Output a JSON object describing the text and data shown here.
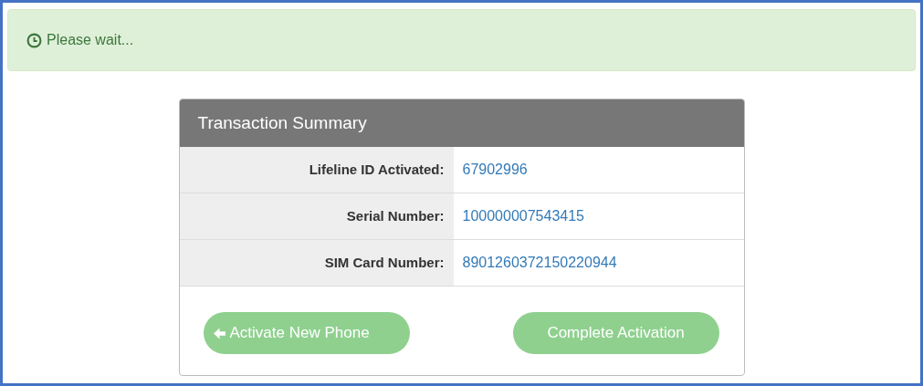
{
  "alert": {
    "text": "Please wait..."
  },
  "summary": {
    "title": "Transaction Summary",
    "rows": [
      {
        "label": "Lifeline ID Activated:",
        "value": "67902996"
      },
      {
        "label": "Serial Number:",
        "value": "100000007543415"
      },
      {
        "label": "SIM Card Number:",
        "value": "8901260372150220944"
      }
    ],
    "buttons": [
      {
        "label": "Activate New Phone",
        "kind": "back",
        "disabled": true
      },
      {
        "label": "Complete Activation",
        "kind": "plain",
        "disabled": true
      }
    ]
  }
}
